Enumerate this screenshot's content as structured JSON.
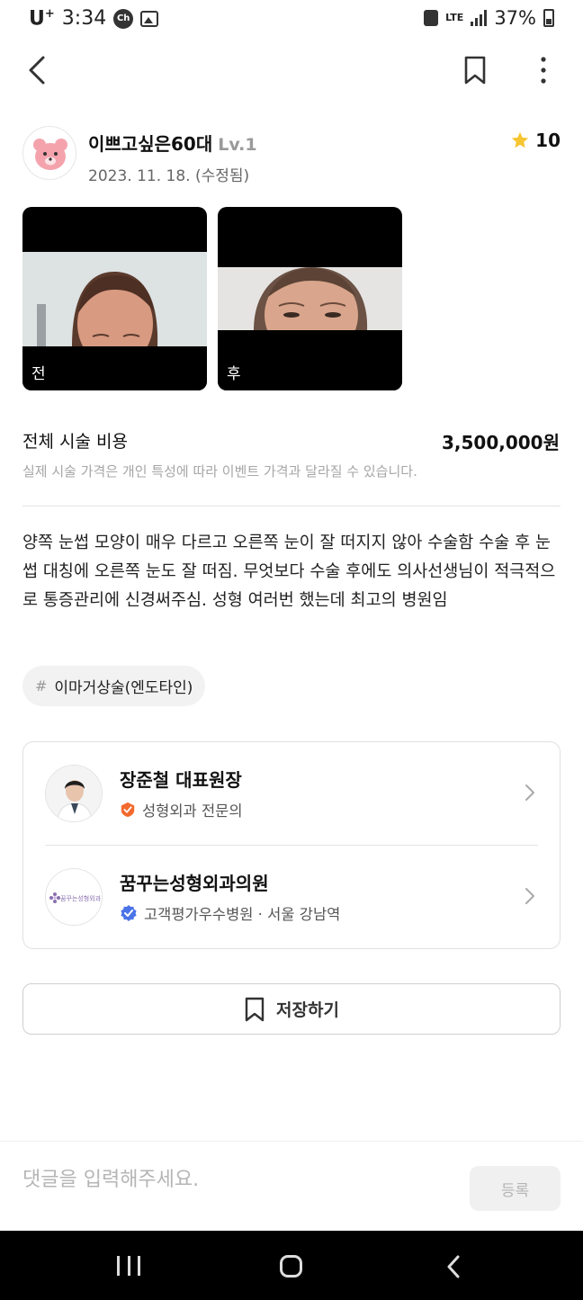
{
  "status_bar": {
    "carrier": "U",
    "carrier_sup": "+",
    "time": "3:34",
    "chat_badge": "Ch",
    "network": "LTE",
    "battery": "37%"
  },
  "author": {
    "name": "이쁘고싶은60대",
    "level": "Lv.1",
    "date": "2023. 11. 18. (수정됨)",
    "rating": "10"
  },
  "photos": [
    {
      "label": "전"
    },
    {
      "label": "후"
    }
  ],
  "price": {
    "label": "전체 시술 비용",
    "value": "3,500,000원",
    "note": "실제 시술 가격은 개인 특성에 따라 이벤트 가격과 달라질 수 있습니다."
  },
  "review": {
    "text": "양쪽 눈썹 모양이 매우 다르고 오른쪽 눈이 잘 떠지지 않아 수술함 수술 후 눈썹 대칭에 오른쪽 눈도 잘 떠짐. 무엇보다 수술 후에도 의사선생님이 적극적으로 통증관리에 신경써주심. 성형 여러번 했는데 최고의 병원임"
  },
  "tag": {
    "hash": "#",
    "label": "이마거상술(엔도타인)"
  },
  "doctor": {
    "name": "장준철 대표원장",
    "specialty": "성형외과 전문의",
    "badge_color": "#f26a2e"
  },
  "clinic": {
    "name": "꿈꾸는성형외과의원",
    "logo_text": "꿈꾸는성형외과",
    "info": "고객평가우수병원 · 서울 강남역",
    "badge_color": "#4a73e8"
  },
  "save_button": {
    "label": "저장하기"
  },
  "comment": {
    "placeholder": "댓글을 입력해주세요.",
    "submit_label": "등록"
  },
  "colors": {
    "star": "#f7c531",
    "accent_orange": "#f26a2e",
    "accent_blue": "#4a73e8"
  }
}
